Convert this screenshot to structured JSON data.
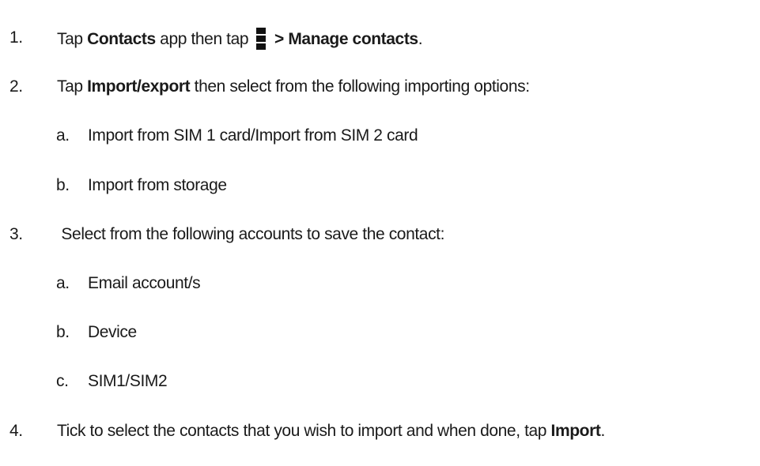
{
  "steps": [
    {
      "num": "1.",
      "pre": "Tap ",
      "bold1": "Contacts",
      "mid": " app then tap ",
      "icon": "menu-icon",
      "bold2": " > Manage contacts",
      "post": "."
    },
    {
      "num": "2.",
      "pre": "Tap ",
      "bold1": "Import/export",
      "post": " then select from the following importing options:",
      "sub": [
        {
          "num": "a.",
          "text": "Import from SIM 1 card/Import from SIM 2 card"
        },
        {
          "num": "b.",
          "text": "Import from storage"
        }
      ]
    },
    {
      "num": "3.",
      "text": " Select from the following accounts to save the contact:",
      "sub": [
        {
          "num": "a.",
          "text": "Email account/s"
        },
        {
          "num": "b.",
          "text": "Device"
        },
        {
          "num": "c.",
          "text": "SIM1/SIM2"
        }
      ]
    },
    {
      "num": "4.",
      "pre": "Tick to select the contacts that you wish to import and when done, tap ",
      "bold1": "Import",
      "post": "."
    }
  ]
}
